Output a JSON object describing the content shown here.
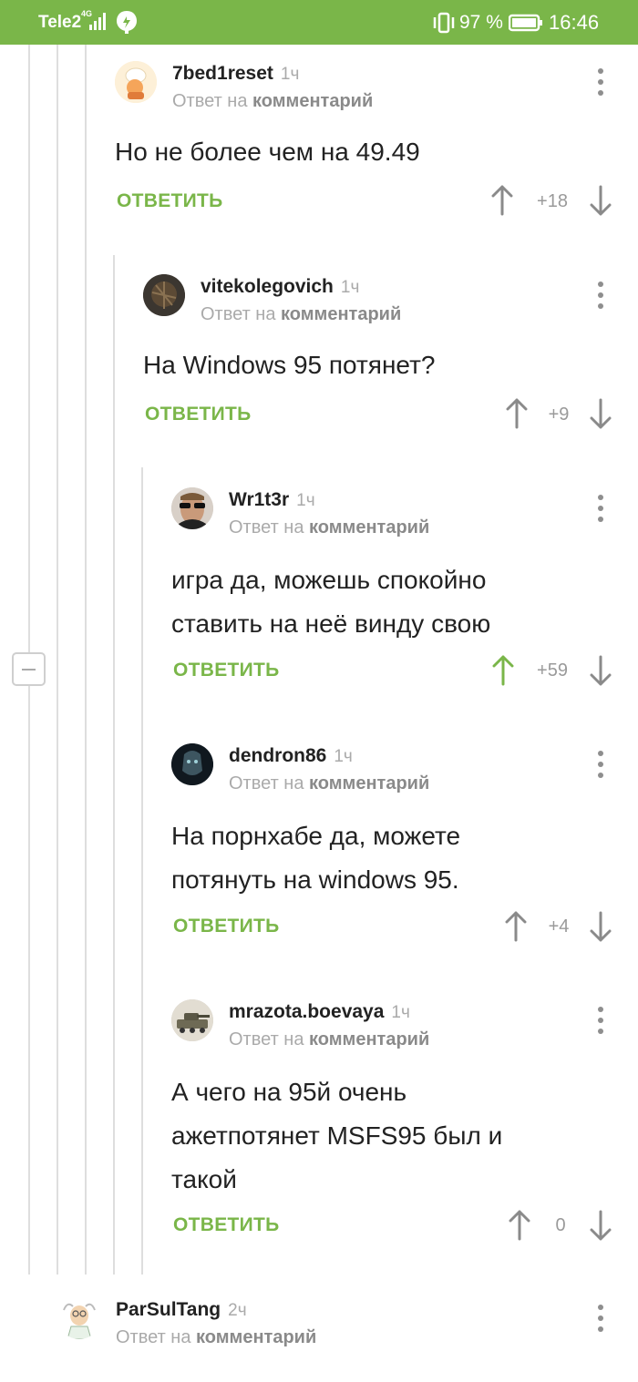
{
  "status_bar": {
    "carrier": "Tele2",
    "network": "4G",
    "battery_percent": "97 %",
    "time": "16:46",
    "icons": [
      "signal-icon",
      "leaf-icon",
      "vibrate-icon",
      "battery-icon"
    ]
  },
  "colors": {
    "accent": "#7ab649",
    "text": "#222222",
    "muted": "#aaaaaa",
    "upvoted": "#7ab649"
  },
  "reply_to_prefix": "Ответ на",
  "reply_to_link": "комментарий",
  "reply_label": "ОТВЕТИТЬ",
  "comments": [
    {
      "username": "7bed1reset",
      "time": "1ч",
      "text": [
        "Но не более чем на 49.49"
      ],
      "score": "+18",
      "upvoted": false
    },
    {
      "username": "vitekolegovich",
      "time": "1ч",
      "text": [
        "На Windows 95 потянет?"
      ],
      "score": "+9",
      "upvoted": false
    },
    {
      "username": "Wr1t3r",
      "time": "1ч",
      "text": [
        "игра да, можешь спокойно",
        "ставить на неё винду свою"
      ],
      "score": "+59",
      "upvoted": true
    },
    {
      "username": "dendron86",
      "time": "1ч",
      "text": [
        "На порнхабе да, можете",
        "потянуть на windows 95."
      ],
      "score": "+4",
      "upvoted": false
    },
    {
      "username": "mrazota.boevaya",
      "time": "1ч",
      "text": [
        "А чего на 95й очень",
        "ажетпотянет MSFS95 был и",
        "такой"
      ],
      "score": "0",
      "upvoted": false
    },
    {
      "username": "ParSulTang",
      "time": "2ч",
      "text": [],
      "score": "",
      "upvoted": false
    }
  ]
}
